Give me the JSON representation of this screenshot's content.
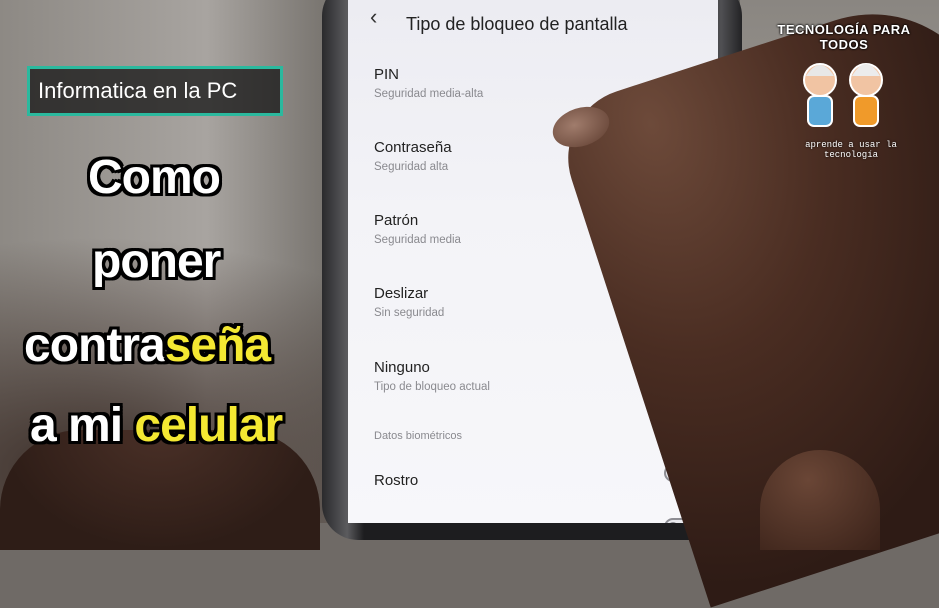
{
  "overlay": {
    "badge": "Informatica en la PC",
    "headline": {
      "line1": "Como",
      "line2": "poner",
      "line3_a": "contra",
      "line3_b": "seña",
      "line4_a": "a mi ",
      "line4_b": "celular"
    },
    "logo": {
      "title": "TECNOLOGÍA PARA TODOS",
      "subtitle": "aprende a usar la tecnología"
    }
  },
  "screen": {
    "title": "Tipo de bloqueo de pantalla",
    "back_icon": "chevron-left-icon",
    "options": [
      {
        "title": "PIN",
        "subtitle": "Seguridad media-alta"
      },
      {
        "title": "Contraseña",
        "subtitle": "Seguridad alta"
      },
      {
        "title": "Patrón",
        "subtitle": "Seguridad media"
      },
      {
        "title": "Deslizar",
        "subtitle": "Sin seguridad"
      },
      {
        "title": "Ninguno",
        "subtitle": "Tipo de bloqueo actual"
      }
    ],
    "section_label": "Datos biométricos",
    "biometrics": [
      {
        "label": "Rostro",
        "enabled": false
      }
    ]
  },
  "colors": {
    "badge_border": "#2bb99e",
    "headline_accent": "#f4e832",
    "screen_bg": "#f3f3f7"
  }
}
